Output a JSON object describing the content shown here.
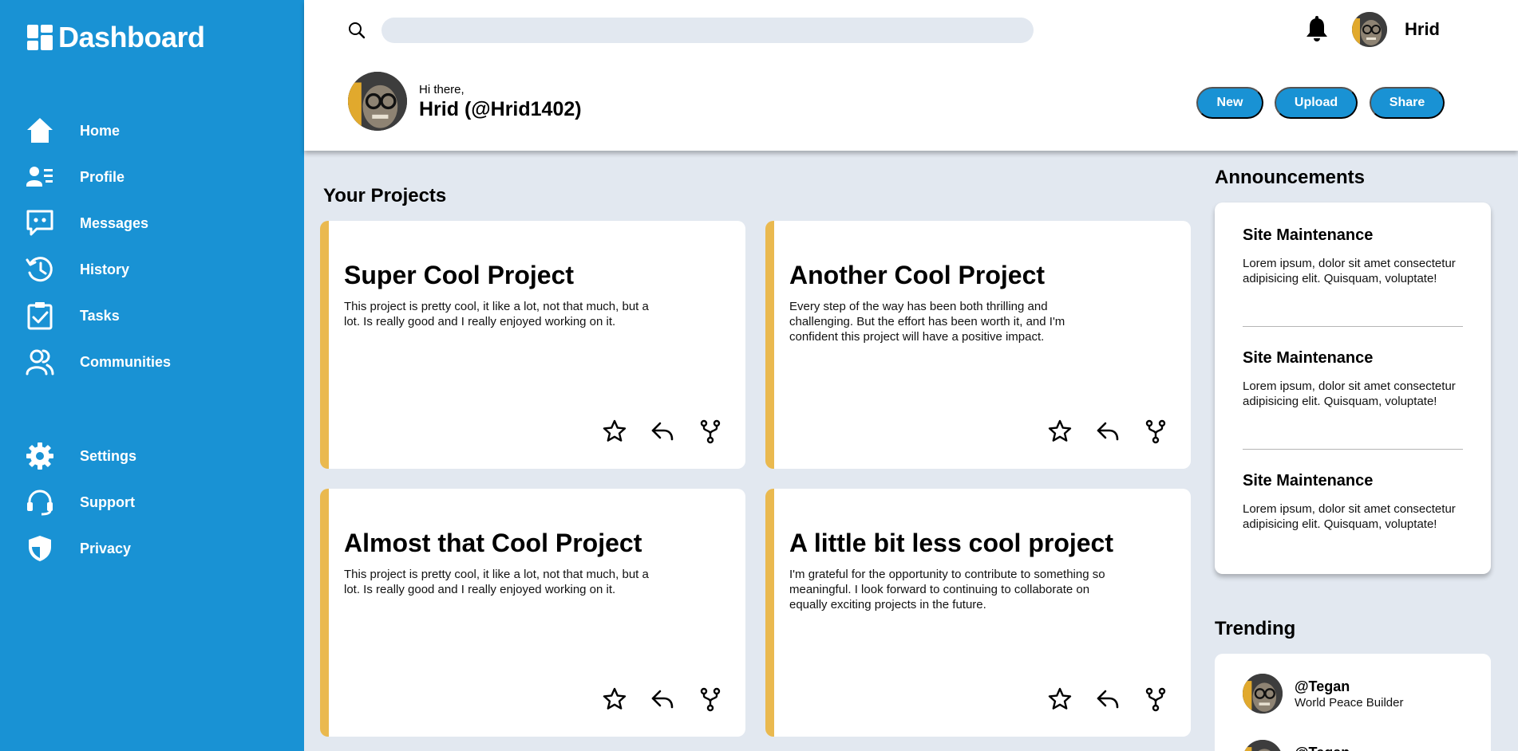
{
  "sidebar": {
    "logo": "Dashboard",
    "items": [
      {
        "label": "Home",
        "icon": "home-icon"
      },
      {
        "label": "Profile",
        "icon": "profile-icon"
      },
      {
        "label": "Messages",
        "icon": "messages-icon"
      },
      {
        "label": "History",
        "icon": "history-icon"
      },
      {
        "label": "Tasks",
        "icon": "tasks-icon"
      },
      {
        "label": "Communities",
        "icon": "communities-icon"
      },
      {
        "label": "Settings",
        "icon": "settings-icon"
      },
      {
        "label": "Support",
        "icon": "support-icon"
      },
      {
        "label": "Privacy",
        "icon": "privacy-icon"
      }
    ]
  },
  "header": {
    "search": {
      "placeholder": ""
    },
    "username": "Hrid",
    "greeting": "Hi there,",
    "full_name": "Hrid (@Hrid1402)",
    "buttons": {
      "new": "New",
      "upload": "Upload",
      "share": "Share"
    }
  },
  "projects": {
    "title": "Your Projects",
    "cards": [
      {
        "title": "Super Cool Project",
        "description": "This project is pretty cool, it like a lot, not that much, but a lot. Is really good and I really enjoyed working on it."
      },
      {
        "title": "Another Cool Project",
        "description": "Every step of the way has been both thrilling and challenging. But the effort has been worth it, and I'm confident this project will have a positive impact."
      },
      {
        "title": "Almost that Cool Project",
        "description": "This project is pretty cool, it like a lot, not that much, but a lot. Is really good and I really enjoyed working on it."
      },
      {
        "title": "A little bit less cool project",
        "description": "I'm grateful for the opportunity to contribute to something so meaningful. I look forward to continuing to collaborate on equally exciting projects in the future."
      }
    ]
  },
  "announcements": {
    "title": "Announcements",
    "items": [
      {
        "title": "Site Maintenance",
        "text": "Lorem ipsum, dolor sit amet consectetur adipisicing elit. Quisquam, voluptate!"
      },
      {
        "title": "Site Maintenance",
        "text": "Lorem ipsum, dolor sit amet consectetur adipisicing elit. Quisquam, voluptate!"
      },
      {
        "title": "Site Maintenance",
        "text": "Lorem ipsum, dolor sit amet consectetur adipisicing elit. Quisquam, voluptate!"
      }
    ]
  },
  "trending": {
    "title": "Trending",
    "items": [
      {
        "handle": "@Tegan",
        "role": "World Peace Builder"
      },
      {
        "handle": "@Tegan",
        "role": ""
      }
    ]
  },
  "colors": {
    "sidebar": "#1992d4",
    "accent": "#eab94f",
    "background": "#e2e8f0"
  }
}
